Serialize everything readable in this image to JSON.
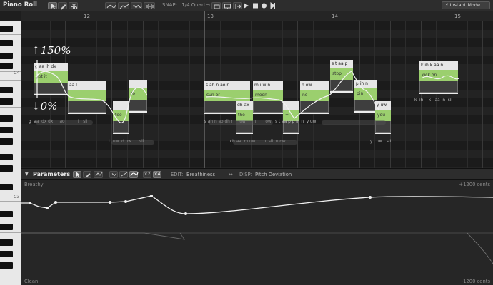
{
  "toolbar": {
    "title": "Piano Roll",
    "snap_label": "SNAP:",
    "snap_value": "1/4 Quarter",
    "play_icon": "play-icon",
    "stop_icon": "stop-icon",
    "record_icon": "record-icon",
    "skip_icon": "skip-to-end-icon",
    "instant_mode": "⚡ Instant Mode"
  },
  "ruler": {
    "bars": [
      "12",
      "13",
      "14",
      "15"
    ]
  },
  "keyboard": {
    "labels": [
      "C4",
      "C3"
    ]
  },
  "annotations": {
    "top": "↑150%",
    "bottom": "↓0%"
  },
  "notes": [
    {
      "lyric": "g aa   ih dx",
      "green": "got    it"
    },
    {
      "lyric": "aa l",
      "green": ""
    },
    {
      "lyric": "",
      "green": "too"
    },
    {
      "lyric": "",
      "green": "to"
    },
    {
      "lyric": "s ah n   ao r",
      "green": "sun    or"
    },
    {
      "lyric": "m uw n",
      "green": "moon"
    },
    {
      "lyric": "dh ax",
      "green": "the"
    },
    {
      "lyric": "n ow",
      "green": "no"
    },
    {
      "lyric": "",
      "green": "+"
    },
    {
      "lyric": "s t aa p",
      "green": "stop"
    },
    {
      "lyric": "p ih n",
      "green": "pin"
    },
    {
      "lyric": "y uw",
      "green": "you"
    },
    {
      "lyric": "k ih k      aa n",
      "green": "kick       on"
    }
  ],
  "phonemes": {
    "row1": [
      "g",
      "aa",
      "dx",
      "dx",
      "ao",
      "l",
      "sil"
    ],
    "row2": [
      "s",
      "ah",
      "n",
      "ao",
      "dh",
      "r",
      "uw",
      "n",
      "ow",
      "s",
      "t",
      "aa",
      "p",
      "p",
      "ih",
      "n",
      "y",
      "uw"
    ],
    "row3": [
      "t",
      "uw",
      "d",
      "uw",
      "sil"
    ],
    "row4": [
      "ch",
      "aa",
      "m",
      "uw",
      "n",
      "sil",
      "n",
      "ow"
    ],
    "row5": [
      "y",
      "uw",
      "sil"
    ],
    "row6": [
      "k",
      "ih",
      "k",
      "aa",
      "n",
      "sil"
    ]
  },
  "parameters": {
    "title": "Parameters",
    "edit_label": "EDIT:",
    "edit_value": "Breathiness",
    "disp_label": "DISP:",
    "disp_value": "Pitch Deviation",
    "swap_icon": "swap-arrows-icon",
    "x2_label": "×2",
    "x4_label": "×4",
    "top_label": "Breathy",
    "bottom_label": "Clean",
    "top_right": "+1200 cents",
    "bottom_right": "-1200 cents"
  },
  "colors": {
    "note_green": "#9bcf6e",
    "note_lyric_bg": "#e6e6e6",
    "grid_bg": "#232323",
    "panel_bg": "#2d2d2d"
  }
}
